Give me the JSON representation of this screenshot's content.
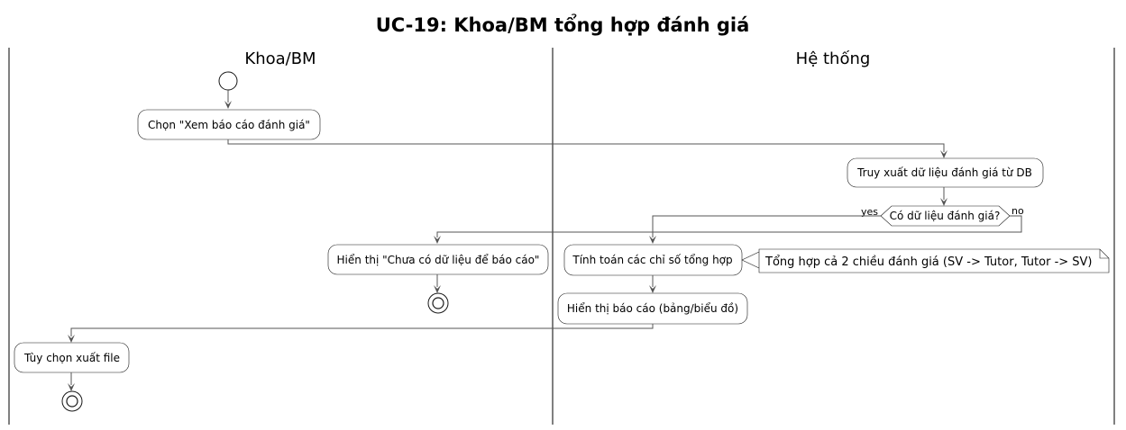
{
  "title": "UC-19: Khoa/BM tổng hợp đánh giá",
  "lanes": [
    "Khoa/BM",
    "Hệ thống"
  ],
  "actions": {
    "select_report": "Chọn \"Xem báo cáo đánh giá\"",
    "retrieve_data": "Truy xuất dữ liệu đánh giá từ DB",
    "no_data": "Hiển thị \"Chưa có dữ liệu để báo cáo\"",
    "compute": "Tính toán các chỉ số tổng hợp",
    "show_report": "Hiển thị báo cáo (bảng/biểu đồ)",
    "export": "Tùy chọn xuất file"
  },
  "decision": {
    "question": "Có dữ liệu đánh giá?",
    "yes_label": "yes",
    "no_label": "no"
  },
  "note": "Tổng hợp cả 2 chiều đánh giá (SV -> Tutor, Tutor -> SV)"
}
